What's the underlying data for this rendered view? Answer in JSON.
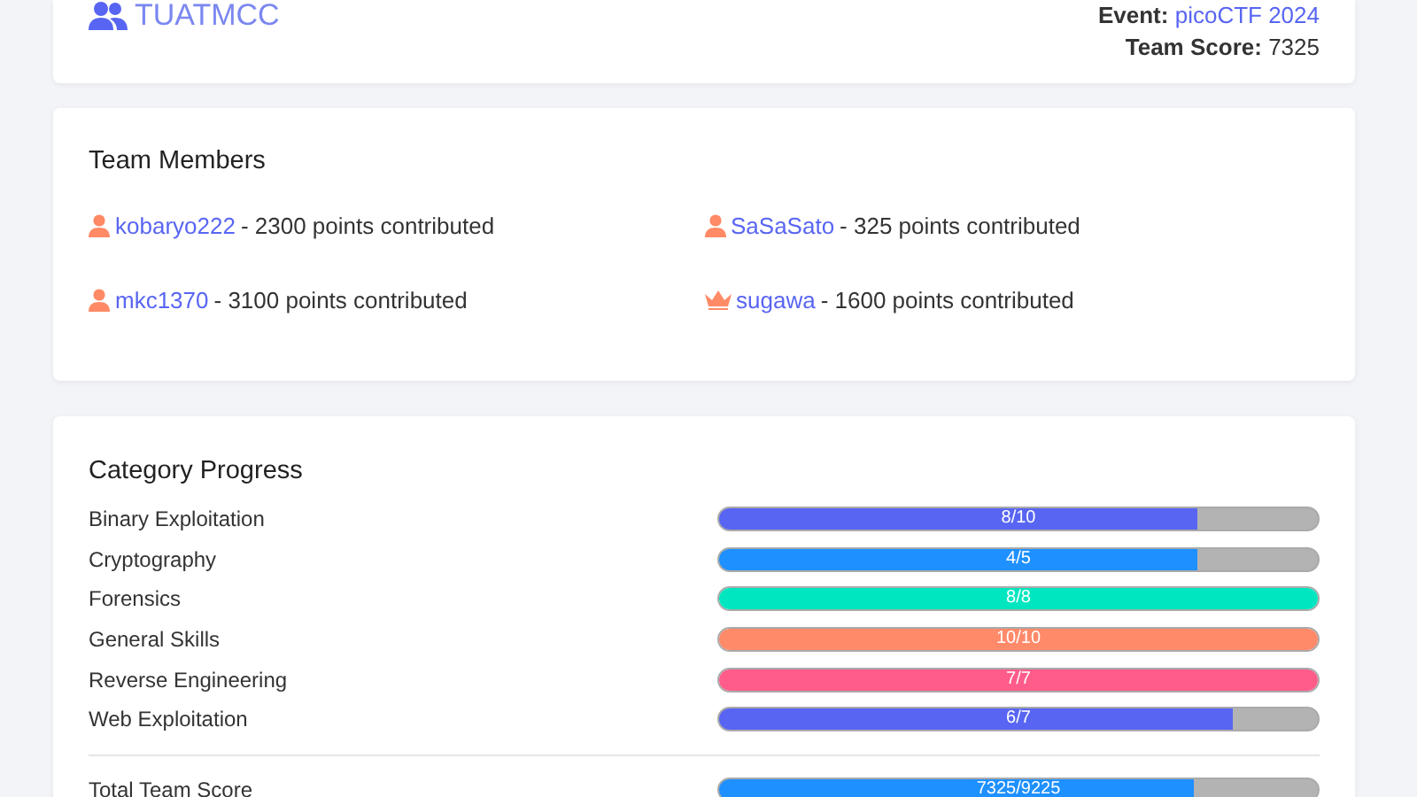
{
  "team": {
    "name": "TUATMCC",
    "event_label": "Event:",
    "event": "picoCTF 2024",
    "score_label": "Team Score:",
    "score": "7325"
  },
  "members_title": "Team Members",
  "members": [
    {
      "kind": "user",
      "name": "kobaryo222",
      "text": "- 2300 points contributed"
    },
    {
      "kind": "user",
      "name": "SaSaSato",
      "text": "- 325 points contributed"
    },
    {
      "kind": "user",
      "name": "mkc1370",
      "text": "- 3100 points contributed"
    },
    {
      "kind": "leader",
      "name": "sugawa",
      "text": "- 1600 points contributed"
    }
  ],
  "progress_title": "Category Progress",
  "categories": [
    {
      "name": "Binary Exploitation",
      "label": "8/10",
      "level": 0.8,
      "color": "#5865f2"
    },
    {
      "name": "Cryptography",
      "label": "4/5",
      "level": 0.8,
      "color": "#1e90ff"
    },
    {
      "name": "Forensics",
      "label": "8/8",
      "level": 1,
      "color": "#00e6c0"
    },
    {
      "name": "General Skills",
      "label": "10/10",
      "level": 1,
      "color": "#ff8a6a"
    },
    {
      "name": "Reverse Engineering",
      "label": "7/7",
      "level": 1,
      "color": "#ff5c8a"
    },
    {
      "name": "Web Exploitation",
      "label": "6/7",
      "level": 0.857,
      "color": "#5865f2"
    }
  ],
  "total": {
    "name": "Total Team Score",
    "label": "7325/9225",
    "level": 0.794,
    "color": "#1e90ff"
  }
}
